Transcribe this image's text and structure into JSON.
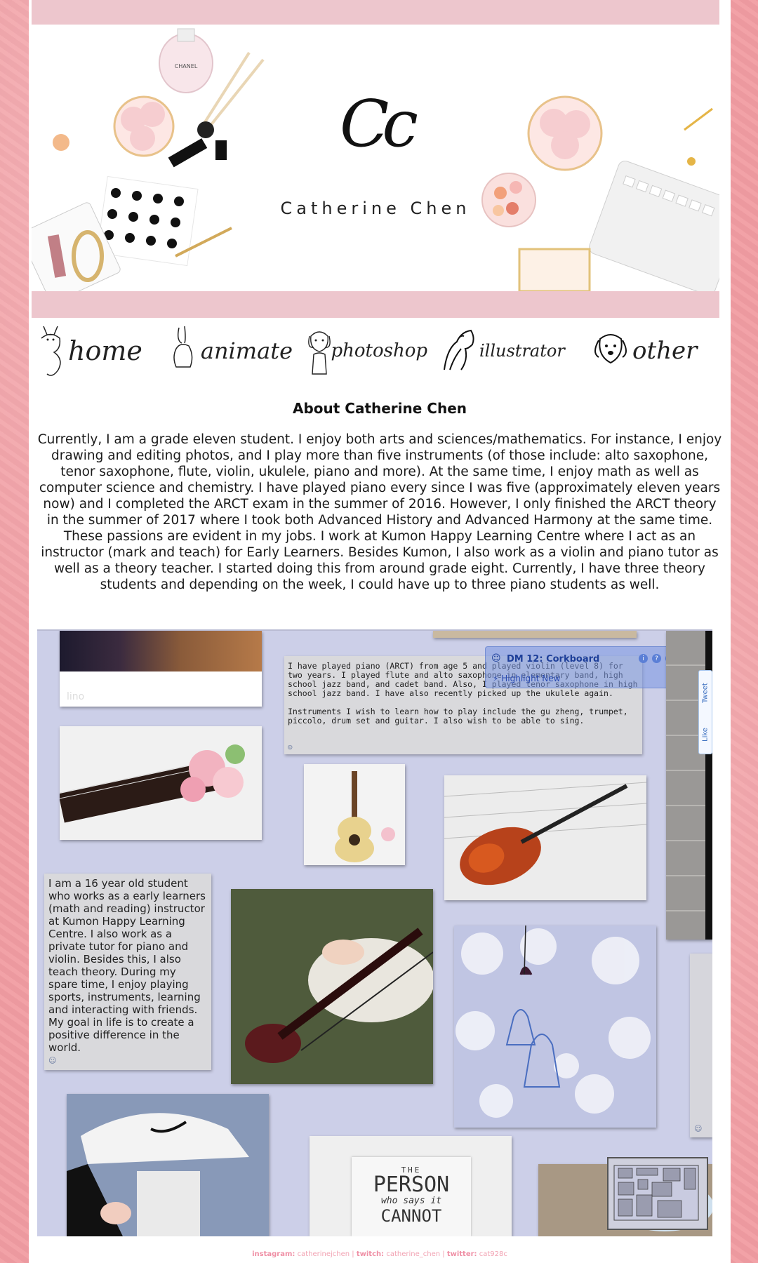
{
  "banner": {
    "logo_mark": "Cc",
    "name": "Catherine Chen",
    "perfume_label": "CHANEL"
  },
  "nav": {
    "items": [
      {
        "label": "home",
        "icon": "cat-icon"
      },
      {
        "label": "animate",
        "icon": "rabbit-icon"
      },
      {
        "label": "photoshop",
        "icon": "puppy-icon"
      },
      {
        "label": "illustrator",
        "icon": "horse-icon"
      },
      {
        "label": "other",
        "icon": "dog-icon"
      }
    ]
  },
  "about": {
    "title": "About Catherine Chen",
    "text": "Currently, I am a grade eleven student. I enjoy both arts and sciences/mathematics. For instance, I enjoy drawing and editing photos, and I play more than five instruments (of those include: alto saxophone, tenor saxophone, flute, violin, ukulele, piano and more). At the same time, I enjoy math as well as computer science and chemistry. I have played piano every since I was five (approximately eleven years now) and I completed the ARCT exam in the summer of 2016. However, I only finished the ARCT theory in the summer of 2017 where I took both Advanced History and Advanced Harmony at the same time. These passions are evident in my jobs. I work at Kumon Happy Learning Centre where I act as an instructor (mark and teach) for Early Learners. Besides Kumon, I also work as a violin and piano tutor as well as a theory teacher. I started doing this from around grade eight. Currently, I have three theory students and depending on the week, I could have up to three piano students as well."
  },
  "corkboard": {
    "note_instruments_1": "I have played piano (ARCT) from age 5 and played violin (level 8) for two years. I played flute and alto saxophone in elementary band, high school jazz band, and cadet band. Also, I played tenor saxophone in high school jazz band. I have also recently picked up the ukulele again.",
    "note_instruments_2": "Instruments I wish to learn how to play include the gu zheng, trumpet, piccolo, drum set and guitar. I also wish to be able to sing.",
    "note_about": "I am a 16 year old student who works as a early learners (math and reading) instructor at Kumon Happy Learning Centre. I also work as a private tutor for piano and violin. Besides this, I also teach theory. During my spare time, I enjoy playing sports, instruments, learning and interacting with friends. My goal in life is to create a positive difference in the world.",
    "quote_the": "THE",
    "quote_person": "PERSON",
    "quote_who": "who says it",
    "quote_cannot": "CANNOT",
    "watermark": "lino",
    "dm_title": "DM 12: Corkboard",
    "dm_highlight": "Highlight New",
    "social_like": "Like",
    "social_tweet": "Tweet"
  },
  "footer": {
    "instagram_label": "instagram:",
    "instagram_value": "catherinejchen",
    "twitch_label": "twitch:",
    "twitch_value": "catherine_chen",
    "twitter_label": "twitter:",
    "twitter_value": "cat928c",
    "separator": "|"
  }
}
